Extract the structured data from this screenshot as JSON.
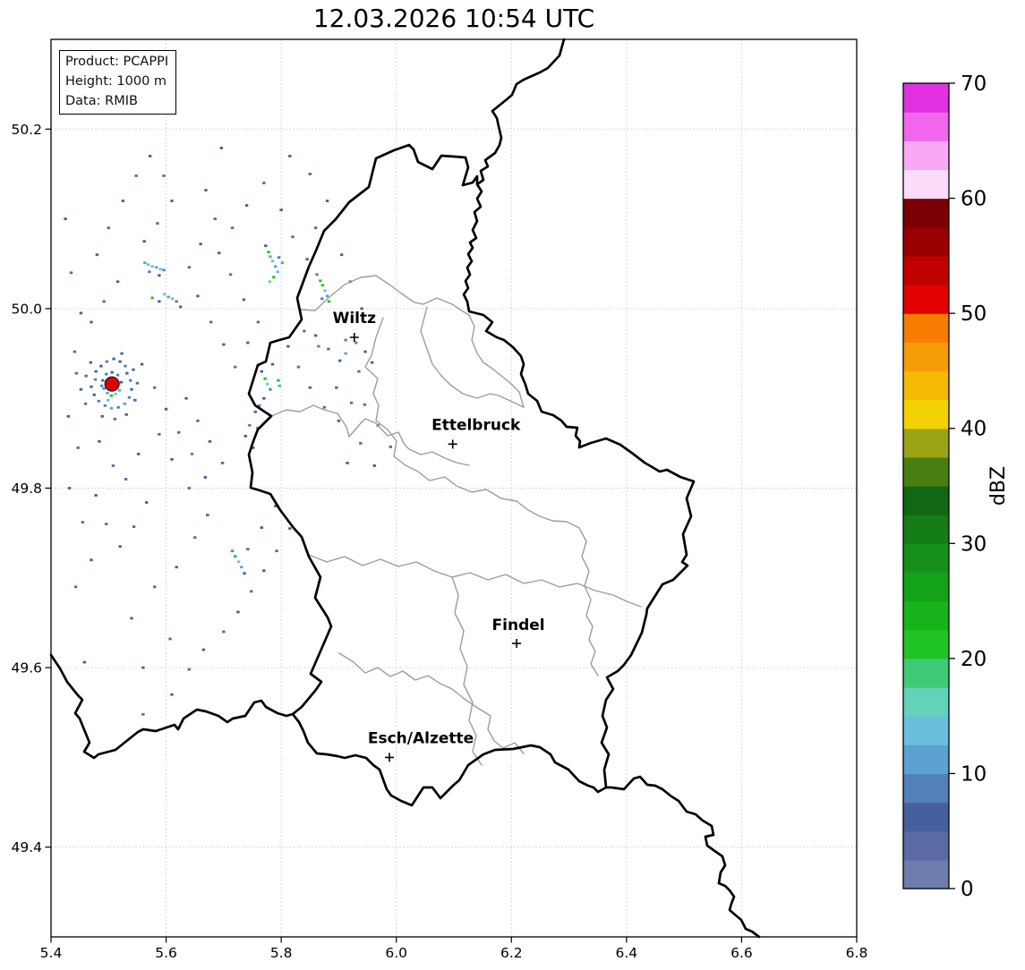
{
  "title": "12.03.2026 10:54 UTC",
  "info_box": {
    "lines": [
      "Product: PCAPPI",
      "Height: 1000 m",
      "Data: RMIB"
    ]
  },
  "axes": {
    "xlim": [
      5.4,
      6.8
    ],
    "ylim": [
      49.3,
      50.3
    ],
    "xticks": [
      "5.4",
      "5.6",
      "5.8",
      "6.0",
      "6.2",
      "6.4",
      "6.6",
      "6.8"
    ],
    "yticks": [
      "49.4",
      "49.6",
      "49.8",
      "50.0",
      "50.2"
    ],
    "grid": true
  },
  "colorbar": {
    "label": "dBZ",
    "min": 0,
    "max": 70,
    "ticks": [
      0,
      10,
      20,
      30,
      40,
      50,
      60,
      70
    ],
    "segment_step": 2.5,
    "colors_bottom_to_top": [
      "#6e7dab",
      "#5a6aa2",
      "#485f9d",
      "#5280b8",
      "#5ba2d2",
      "#68c0dc",
      "#62d2b8",
      "#3fcb76",
      "#21c426",
      "#18b41c",
      "#14a317",
      "#179019",
      "#157d17",
      "#126712",
      "#497e11",
      "#9aa313",
      "#f2d202",
      "#f5ba04",
      "#f69c04",
      "#f67d02",
      "#e20202",
      "#c00000",
      "#9b0000",
      "#7a0004",
      "#fcdcfa",
      "#f8a9f3",
      "#f266ee",
      "#e132e1"
    ]
  },
  "cities": [
    {
      "name": "Wiltz",
      "lon": 5.927,
      "lat": 49.968,
      "label_dx": 0,
      "label_dy": -16
    },
    {
      "name": "Ettelbruck",
      "lon": 6.098,
      "lat": 49.849,
      "label_dx": 26,
      "label_dy": -16
    },
    {
      "name": "Findel",
      "lon": 6.209,
      "lat": 49.627,
      "label_dx": 2,
      "label_dy": -15
    },
    {
      "name": "Esch/Alzette",
      "lon": 5.988,
      "lat": 49.5,
      "label_dx": 35,
      "label_dy": -16
    }
  ],
  "radar_site": {
    "lon": 5.506,
    "lat": 49.916,
    "color": "#dd0000"
  },
  "radar_echoes": {
    "points": [
      [
        5.478,
        49.93,
        2
      ],
      [
        5.487,
        49.936,
        2
      ],
      [
        5.497,
        49.941,
        3
      ],
      [
        5.509,
        49.944,
        2
      ],
      [
        5.52,
        49.941,
        2
      ],
      [
        5.529,
        49.936,
        3
      ],
      [
        5.477,
        49.921,
        3
      ],
      [
        5.47,
        49.913,
        2
      ],
      [
        5.475,
        49.904,
        2
      ],
      [
        5.483,
        49.897,
        3
      ],
      [
        5.494,
        49.892,
        3
      ],
      [
        5.505,
        49.889,
        4
      ],
      [
        5.517,
        49.89,
        3
      ],
      [
        5.528,
        49.894,
        4
      ],
      [
        5.536,
        49.901,
        3
      ],
      [
        5.54,
        49.91,
        2
      ],
      [
        5.538,
        49.92,
        3
      ],
      [
        5.532,
        49.928,
        2
      ],
      [
        5.512,
        49.905,
        6
      ],
      [
        5.505,
        49.903,
        8
      ],
      [
        5.498,
        49.906,
        4
      ],
      [
        5.492,
        49.911,
        3
      ],
      [
        5.49,
        49.92,
        2
      ],
      [
        5.496,
        49.927,
        3
      ],
      [
        5.506,
        49.929,
        2
      ],
      [
        5.516,
        49.926,
        3
      ],
      [
        5.522,
        49.918,
        2
      ],
      [
        5.519,
        49.909,
        4
      ],
      [
        5.499,
        49.898,
        5
      ],
      [
        5.488,
        49.914,
        3
      ],
      [
        5.461,
        49.925,
        1
      ],
      [
        5.452,
        49.91,
        2
      ],
      [
        5.46,
        49.894,
        1
      ],
      [
        5.523,
        49.95,
        2
      ],
      [
        5.543,
        49.932,
        2
      ],
      [
        5.55,
        49.917,
        1
      ],
      [
        5.546,
        49.898,
        2
      ],
      [
        5.531,
        49.882,
        2
      ],
      [
        5.511,
        49.877,
        1
      ],
      [
        5.489,
        49.88,
        2
      ],
      [
        5.469,
        49.94,
        2
      ],
      [
        5.444,
        49.928,
        1
      ],
      [
        5.563,
        50.051,
        4
      ],
      [
        5.569,
        50.049,
        5
      ],
      [
        5.576,
        50.047,
        5
      ],
      [
        5.583,
        50.046,
        4
      ],
      [
        5.59,
        50.044,
        5
      ],
      [
        5.596,
        50.043,
        3
      ],
      [
        5.571,
        50.041,
        3
      ],
      [
        5.588,
        50.037,
        2
      ],
      [
        5.773,
        50.07,
        2
      ],
      [
        5.778,
        50.063,
        8
      ],
      [
        5.781,
        50.058,
        7
      ],
      [
        5.785,
        50.053,
        5
      ],
      [
        5.79,
        50.047,
        4
      ],
      [
        5.794,
        50.041,
        5
      ],
      [
        5.787,
        50.035,
        8
      ],
      [
        5.78,
        50.03,
        6
      ],
      [
        5.796,
        50.057,
        3
      ],
      [
        5.802,
        50.051,
        4
      ],
      [
        5.868,
        50.031,
        8
      ],
      [
        5.872,
        50.026,
        8
      ],
      [
        5.876,
        50.02,
        5
      ],
      [
        5.88,
        50.014,
        4
      ],
      [
        5.883,
        50.008,
        8
      ],
      [
        5.871,
        50.011,
        3
      ],
      [
        5.862,
        50.038,
        3
      ],
      [
        5.597,
        50.016,
        5
      ],
      [
        5.604,
        50.013,
        4
      ],
      [
        5.611,
        50.011,
        5
      ],
      [
        5.618,
        50.008,
        3
      ],
      [
        5.576,
        50.012,
        8
      ],
      [
        5.588,
        50.008,
        2
      ],
      [
        5.625,
        50.002,
        2
      ],
      [
        5.76,
        49.937,
        3
      ],
      [
        5.766,
        49.93,
        2
      ],
      [
        5.772,
        49.922,
        8
      ],
      [
        5.776,
        49.916,
        6
      ],
      [
        5.781,
        49.91,
        3
      ],
      [
        5.797,
        49.914,
        7
      ],
      [
        5.795,
        49.92,
        8
      ],
      [
        5.77,
        49.9,
        2
      ],
      [
        5.762,
        49.892,
        3
      ],
      [
        5.759,
        49.867,
        8
      ],
      [
        5.755,
        49.885,
        2
      ],
      [
        5.785,
        49.938,
        2
      ],
      [
        5.745,
        49.87,
        3
      ],
      [
        5.738,
        49.858,
        2
      ],
      [
        5.751,
        49.845,
        2
      ],
      [
        5.72,
        49.724,
        8
      ],
      [
        5.726,
        49.718,
        6
      ],
      [
        5.731,
        49.712,
        4
      ],
      [
        5.715,
        49.73,
        3
      ],
      [
        5.736,
        49.705,
        2
      ],
      [
        5.425,
        50.1,
        2
      ],
      [
        5.435,
        50.04,
        1
      ],
      [
        5.452,
        49.995,
        2
      ],
      [
        5.441,
        49.952,
        1
      ],
      [
        5.43,
        49.88,
        2
      ],
      [
        5.447,
        49.845,
        1
      ],
      [
        5.432,
        49.8,
        2
      ],
      [
        5.455,
        49.762,
        1
      ],
      [
        5.47,
        49.72,
        2
      ],
      [
        5.443,
        49.69,
        1
      ],
      [
        5.458,
        49.606,
        2
      ],
      [
        5.56,
        49.6,
        2
      ],
      [
        5.607,
        49.632,
        1
      ],
      [
        5.54,
        49.655,
        2
      ],
      [
        5.58,
        49.69,
        1
      ],
      [
        5.618,
        49.712,
        2
      ],
      [
        5.65,
        49.745,
        1
      ],
      [
        5.672,
        49.77,
        2
      ],
      [
        5.64,
        49.8,
        1
      ],
      [
        5.61,
        49.832,
        2
      ],
      [
        5.588,
        49.86,
        1
      ],
      [
        5.552,
        49.838,
        2
      ],
      [
        5.53,
        49.81,
        1
      ],
      [
        5.566,
        49.784,
        2
      ],
      [
        5.544,
        49.757,
        1
      ],
      [
        5.52,
        49.735,
        2
      ],
      [
        5.496,
        49.76,
        1
      ],
      [
        5.478,
        49.792,
        2
      ],
      [
        5.508,
        49.825,
        1
      ],
      [
        5.484,
        49.852,
        2
      ],
      [
        5.696,
        50.179,
        2
      ],
      [
        5.669,
        50.132,
        2
      ],
      [
        5.685,
        50.1,
        1
      ],
      [
        5.66,
        50.072,
        2
      ],
      [
        5.64,
        50.046,
        1
      ],
      [
        5.655,
        50.014,
        2
      ],
      [
        5.678,
        49.985,
        1
      ],
      [
        5.7,
        49.96,
        2
      ],
      [
        5.72,
        49.935,
        1
      ],
      [
        5.742,
        49.962,
        2
      ],
      [
        5.76,
        49.985,
        1
      ],
      [
        5.735,
        50.01,
        2
      ],
      [
        5.712,
        50.038,
        1
      ],
      [
        5.692,
        50.062,
        2
      ],
      [
        5.715,
        50.09,
        1
      ],
      [
        5.74,
        50.115,
        2
      ],
      [
        5.77,
        50.14,
        1
      ],
      [
        5.8,
        50.11,
        2
      ],
      [
        5.82,
        50.08,
        1
      ],
      [
        5.845,
        50.055,
        2
      ],
      [
        5.86,
        50.09,
        1
      ],
      [
        5.88,
        50.12,
        2
      ],
      [
        5.85,
        50.15,
        1
      ],
      [
        5.815,
        50.17,
        2
      ],
      [
        5.905,
        50.06,
        2
      ],
      [
        5.92,
        50.03,
        1
      ],
      [
        5.94,
        50.0,
        2
      ],
      [
        5.912,
        49.965,
        3
      ],
      [
        5.946,
        49.952,
        2
      ],
      [
        5.958,
        49.94,
        2
      ],
      [
        5.935,
        49.93,
        1
      ],
      [
        5.902,
        49.942,
        2
      ],
      [
        5.882,
        49.955,
        1
      ],
      [
        5.896,
        49.912,
        2
      ],
      [
        5.922,
        49.895,
        1
      ],
      [
        5.9,
        49.875,
        2
      ],
      [
        5.875,
        49.89,
        1
      ],
      [
        5.85,
        49.912,
        2
      ],
      [
        5.83,
        49.935,
        1
      ],
      [
        5.812,
        49.958,
        2
      ],
      [
        5.84,
        49.975,
        1
      ],
      [
        5.865,
        49.958,
        3
      ],
      [
        5.48,
        50.06,
        2
      ],
      [
        5.5,
        50.09,
        1
      ],
      [
        5.525,
        50.12,
        2
      ],
      [
        5.548,
        50.148,
        1
      ],
      [
        5.572,
        50.17,
        2
      ],
      [
        5.596,
        50.148,
        1
      ],
      [
        5.61,
        50.12,
        2
      ],
      [
        5.585,
        50.095,
        1
      ],
      [
        5.562,
        50.075,
        2
      ],
      [
        5.516,
        50.03,
        2
      ],
      [
        5.492,
        50.008,
        1
      ],
      [
        5.47,
        49.985,
        2
      ],
      [
        5.635,
        49.9,
        2
      ],
      [
        5.655,
        49.875,
        1
      ],
      [
        5.676,
        49.852,
        2
      ],
      [
        5.698,
        49.828,
        1
      ],
      [
        5.668,
        49.812,
        2
      ],
      [
        5.645,
        49.838,
        3
      ],
      [
        5.622,
        49.862,
        1
      ],
      [
        5.6,
        49.888,
        2
      ],
      [
        5.58,
        49.912,
        1
      ],
      [
        5.558,
        49.938,
        2
      ],
      [
        5.945,
        49.893,
        1
      ],
      [
        5.968,
        49.87,
        2
      ],
      [
        5.99,
        49.846,
        1
      ],
      [
        5.962,
        49.825,
        2
      ],
      [
        5.938,
        49.85,
        1
      ],
      [
        5.915,
        49.828,
        2
      ],
      [
        5.7,
        49.64,
        1
      ],
      [
        5.725,
        49.662,
        2
      ],
      [
        5.748,
        49.685,
        1
      ],
      [
        5.77,
        49.708,
        2
      ],
      [
        5.792,
        49.73,
        1
      ],
      [
        5.815,
        49.755,
        2
      ],
      [
        5.79,
        49.78,
        1
      ],
      [
        5.766,
        49.756,
        2
      ],
      [
        5.742,
        49.732,
        1
      ],
      [
        5.61,
        49.57,
        2
      ],
      [
        5.56,
        49.548,
        1
      ],
      [
        5.64,
        49.598,
        1
      ],
      [
        5.665,
        49.62,
        2
      ],
      [
        5.86,
        49.97,
        2
      ],
      [
        5.93,
        49.962,
        3
      ],
      [
        5.912,
        49.95,
        4
      ]
    ]
  }
}
